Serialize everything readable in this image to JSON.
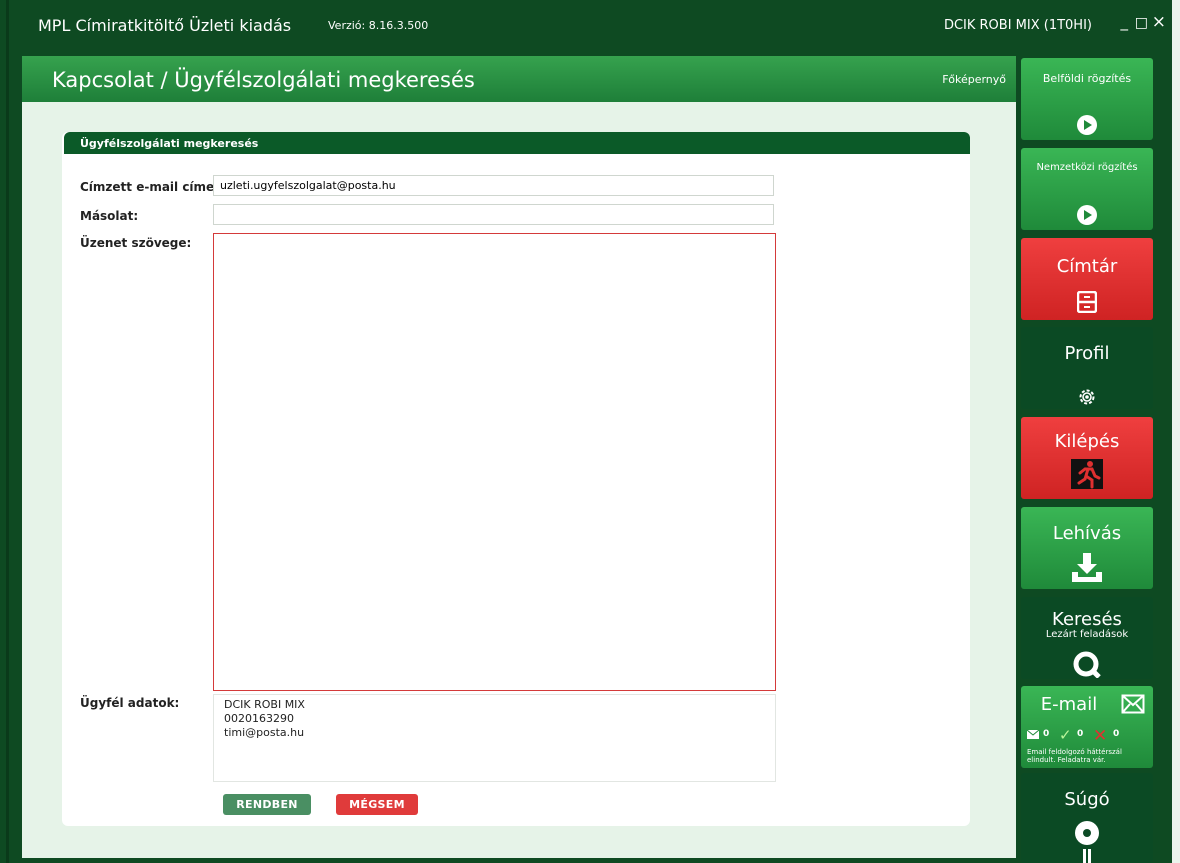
{
  "window": {
    "title": "MPL Címiratkitöltő Üzleti kiadás",
    "version": "Verzió: 8.16.3.500",
    "user": "DCIK ROBI MIX (1T0HI)",
    "minimize": "_",
    "maximize": "□",
    "close": "×"
  },
  "page": {
    "title": "Kapcsolat / Ügyfélszolgálati megkeresés",
    "home_link": "Főképernyő"
  },
  "form": {
    "panel_title": "Ügyfélszolgálati megkeresés",
    "to_label": "Címzett e-mail címe:",
    "to_value": "uzleti.ugyfelszolgalat@posta.hu",
    "cc_label": "Másolat:",
    "cc_value": "",
    "message_label": "Üzenet szövege:",
    "message_value": "",
    "client_label": "Ügyfél adatok:",
    "client_lines": [
      "DCIK ROBI MIX",
      "0020163290",
      "timi@posta.hu"
    ],
    "ok_label": "RENDBEN",
    "cancel_label": "MÉGSEM"
  },
  "sidebar": {
    "tiles": [
      {
        "label": "Belföldi rögzítés",
        "icon": "play-circle-icon"
      },
      {
        "label": "Nemzetközi rögzítés",
        "icon": "play-circle-icon"
      },
      {
        "label": "Címtár",
        "icon": "drawer-cabinet-icon"
      },
      {
        "label": "Profil",
        "icon": "gear-icon"
      },
      {
        "label": "Kilépés",
        "icon": "exit-running-man-icon"
      },
      {
        "label": "Lehívás",
        "icon": "download-tray-icon"
      },
      {
        "label": "Keresés",
        "sublabel": "Lezárt feladások",
        "icon": "search-icon"
      },
      {
        "label": "E-mail",
        "icon": "envelope-icon",
        "counts": [
          "0",
          "0",
          "0"
        ],
        "note": "Email feldolgozó háttérszál elindult. Feladatra vár."
      },
      {
        "label": "Súgó",
        "icon": "help-info-icon"
      }
    ]
  },
  "colors": {
    "dark_green": "#0e4a22",
    "tile_green": "#2aa045",
    "tile_red": "#e03030",
    "tile_dark": "#0b4a24"
  }
}
